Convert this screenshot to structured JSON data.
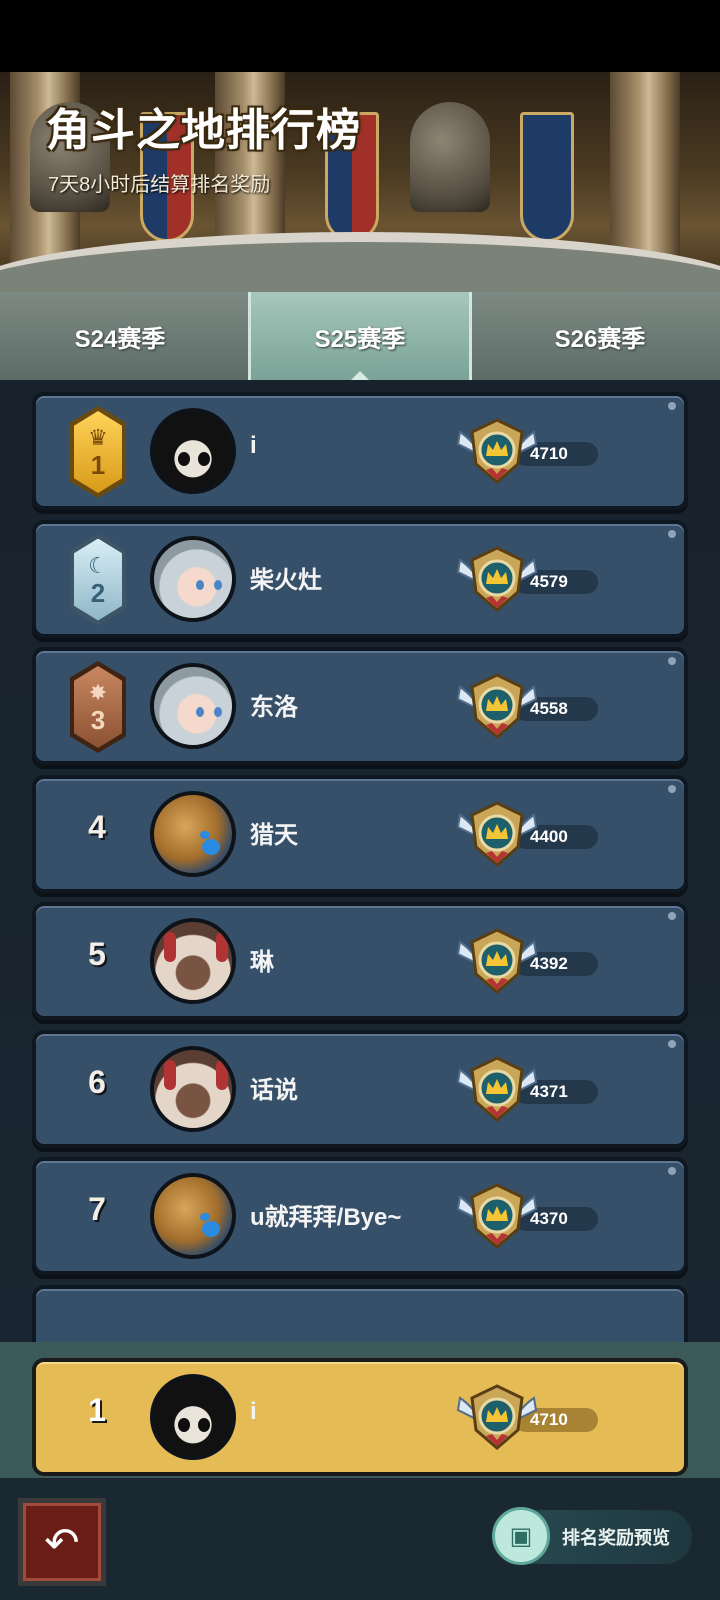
{
  "banner": {
    "title": "角斗之地排行榜",
    "subtitle": "7天8小时后结算排名奖励"
  },
  "tabs": [
    {
      "label": "S24赛季",
      "active": false
    },
    {
      "label": "S25赛季",
      "active": true
    },
    {
      "label": "S26赛季",
      "active": false
    }
  ],
  "rankings": [
    {
      "rank": "1",
      "name": "i",
      "score": "4710",
      "medal": "gold",
      "avatar": "mask-avatar"
    },
    {
      "rank": "2",
      "name": "柴火灶",
      "score": "4579",
      "medal": "silver",
      "avatar": "silver-hair-avatar"
    },
    {
      "rank": "3",
      "name": "东洛",
      "score": "4558",
      "medal": "bronze",
      "avatar": "silver-hair-avatar"
    },
    {
      "rank": "4",
      "name": "猎天",
      "score": "4400",
      "medal": "none",
      "avatar": "bread-avatar"
    },
    {
      "rank": "5",
      "name": "琳",
      "score": "4392",
      "medal": "none",
      "avatar": "white-hair-girl-avatar"
    },
    {
      "rank": "6",
      "name": "话说",
      "score": "4371",
      "medal": "none",
      "avatar": "white-hair-girl-avatar"
    },
    {
      "rank": "7",
      "name": "u就拜拜/Bye~",
      "score": "4370",
      "medal": "none",
      "avatar": "bread-avatar"
    }
  ],
  "my_rank": {
    "rank": "1",
    "name": "i",
    "score": "4710",
    "avatar": "mask-avatar"
  },
  "footer": {
    "back_icon": "back-arrow-icon",
    "reward_preview_label": "排名奖励预览"
  },
  "colors": {
    "row_bg": "#37506a",
    "my_row_bg": "#e4bb54",
    "active_tab": "#8fb6aa"
  }
}
